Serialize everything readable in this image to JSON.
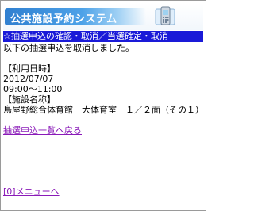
{
  "header": {
    "title": "公共施設予約システム",
    "icon": "mobile-phone-icon"
  },
  "section": {
    "heading": "☆抽選申込の確認・取消／当選確定・取消"
  },
  "message": "以下の抽選申込を取消しました。",
  "details": {
    "datetime_label": "【利用日時】",
    "date": "2012/07/07",
    "time": "09:00～11:00",
    "facility_label": "【施設名称】",
    "facility": "鳥屋野総合体育館　大体育室　１／２面（その１）"
  },
  "links": {
    "back_to_list": "抽選申込一覧へ戻る",
    "menu": "[0]メニューへ"
  },
  "colors": {
    "section_bar": "#1a1ad8",
    "link": "#8a1ab8",
    "banner": "#3a8fdc"
  }
}
